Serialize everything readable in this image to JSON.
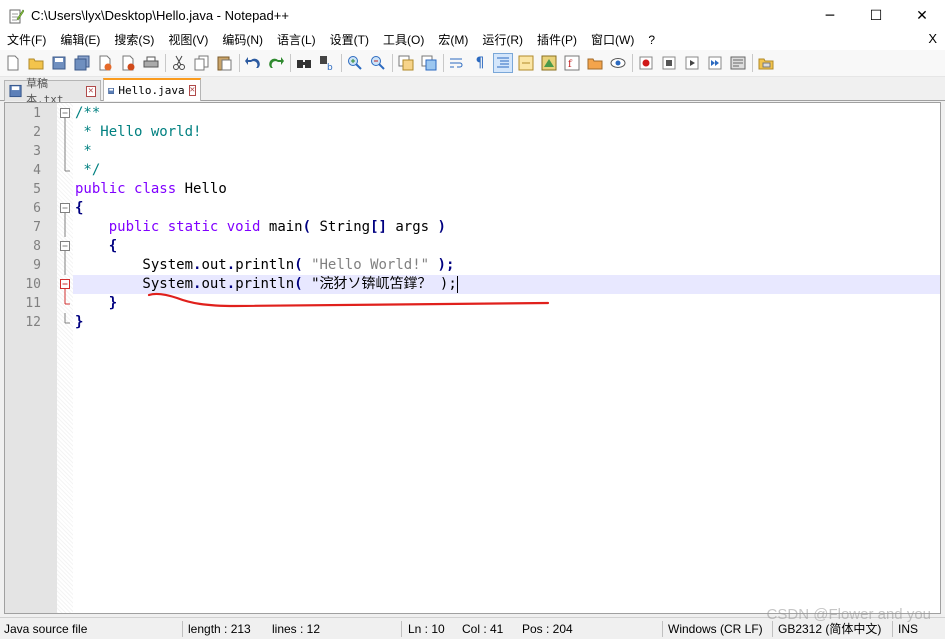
{
  "window": {
    "title": "C:\\Users\\lyx\\Desktop\\Hello.java - Notepad++",
    "minimize": "─",
    "maximize": "☐",
    "close": "✕"
  },
  "menu": {
    "items": [
      "文件(F)",
      "编辑(E)",
      "搜索(S)",
      "视图(V)",
      "编码(N)",
      "语言(L)",
      "设置(T)",
      "工具(O)",
      "宏(M)",
      "运行(R)",
      "插件(P)",
      "窗口(W)",
      "?"
    ],
    "close_doc": "X"
  },
  "toolbar": {
    "icons": [
      "new-file-icon",
      "open-file-icon",
      "save-icon",
      "save-all-icon",
      "close-icon",
      "close-all-icon",
      "print-icon",
      "cut-icon",
      "copy-icon",
      "paste-icon",
      "undo-icon",
      "redo-icon",
      "find-icon",
      "replace-icon",
      "zoom-in-icon",
      "zoom-out-icon",
      "sync-vertical-icon",
      "sync-horizontal-icon",
      "word-wrap-icon",
      "show-all-chars-icon",
      "indent-guide-icon",
      "udl-icon",
      "doc-map-icon",
      "function-list-icon",
      "folder-workspace-icon",
      "monitoring-icon",
      "record-macro-icon",
      "stop-record-icon",
      "play-macro-icon",
      "run-macro-multiple-icon",
      "save-macro-icon",
      "launch-browser-icon"
    ]
  },
  "tabs": [
    {
      "label": "草稿本.txt",
      "active": false
    },
    {
      "label": "Hello.java",
      "active": true
    }
  ],
  "editor": {
    "current_line": 10,
    "lines": [
      {
        "num": "1",
        "fold": "minus",
        "segments": [
          {
            "t": "/**",
            "c": "cm"
          }
        ]
      },
      {
        "num": "2",
        "fold": "bar",
        "segments": [
          {
            "t": " * Hello world!",
            "c": "cm"
          }
        ]
      },
      {
        "num": "3",
        "fold": "bar",
        "segments": [
          {
            "t": " *",
            "c": "cm"
          }
        ]
      },
      {
        "num": "4",
        "fold": "end",
        "segments": [
          {
            "t": " */",
            "c": "cm"
          }
        ]
      },
      {
        "num": "5",
        "fold": "",
        "segments": [
          {
            "t": "public",
            "c": "kw"
          },
          {
            "t": " ",
            "c": "id"
          },
          {
            "t": "class",
            "c": "kw"
          },
          {
            "t": " Hello",
            "c": "id"
          }
        ]
      },
      {
        "num": "6",
        "fold": "minus",
        "segments": [
          {
            "t": "{",
            "c": "op"
          }
        ]
      },
      {
        "num": "7",
        "fold": "bar",
        "segments": [
          {
            "t": "    ",
            "c": "id"
          },
          {
            "t": "public",
            "c": "kw"
          },
          {
            "t": " ",
            "c": "id"
          },
          {
            "t": "static",
            "c": "kw"
          },
          {
            "t": " ",
            "c": "id"
          },
          {
            "t": "void",
            "c": "kw"
          },
          {
            "t": " main",
            "c": "id"
          },
          {
            "t": "(",
            "c": "op"
          },
          {
            "t": " String",
            "c": "id"
          },
          {
            "t": "[]",
            "c": "op"
          },
          {
            "t": " args ",
            "c": "id"
          },
          {
            "t": ")",
            "c": "op"
          }
        ]
      },
      {
        "num": "8",
        "fold": "minus",
        "segments": [
          {
            "t": "    ",
            "c": "id"
          },
          {
            "t": "{",
            "c": "op"
          }
        ]
      },
      {
        "num": "9",
        "fold": "bar",
        "segments": [
          {
            "t": "        System",
            "c": "id"
          },
          {
            "t": ".",
            "c": "op"
          },
          {
            "t": "out",
            "c": "id"
          },
          {
            "t": ".",
            "c": "op"
          },
          {
            "t": "println",
            "c": "id"
          },
          {
            "t": "(",
            "c": "op"
          },
          {
            "t": " ",
            "c": "id"
          },
          {
            "t": "\"Hello World!\"",
            "c": "str"
          },
          {
            "t": " ",
            "c": "id"
          },
          {
            "t": ");",
            "c": "op"
          }
        ]
      },
      {
        "num": "10",
        "fold": "minus-red",
        "segments": [
          {
            "t": "        System",
            "c": "id"
          },
          {
            "t": ".",
            "c": "op"
          },
          {
            "t": "out",
            "c": "id"
          },
          {
            "t": ".",
            "c": "op"
          },
          {
            "t": "println",
            "c": "id"
          },
          {
            "t": "(",
            "c": "op"
          },
          {
            "t": " \"浣犲ソ锛屼笘鐣？ );",
            "c": "id"
          }
        ]
      },
      {
        "num": "11",
        "fold": "end-red",
        "segments": [
          {
            "t": "    ",
            "c": "id"
          },
          {
            "t": "}",
            "c": "op"
          }
        ]
      },
      {
        "num": "12",
        "fold": "end",
        "segments": [
          {
            "t": "}",
            "c": "op"
          }
        ]
      }
    ]
  },
  "status": {
    "file_type": "Java source file",
    "length": "length : 213",
    "lines": "lines : 12",
    "ln": "Ln : 10",
    "col": "Col : 41",
    "pos": "Pos : 204",
    "eol": "Windows (CR LF)",
    "encoding": "GB2312 (简体中文)",
    "mode": "INS"
  },
  "watermark": "CSDN @Flower and you",
  "colors": {
    "tab_accent": "#fa9b1e",
    "current_line_bg": "#e8e8ff",
    "annotation_red": "#e0201c"
  }
}
